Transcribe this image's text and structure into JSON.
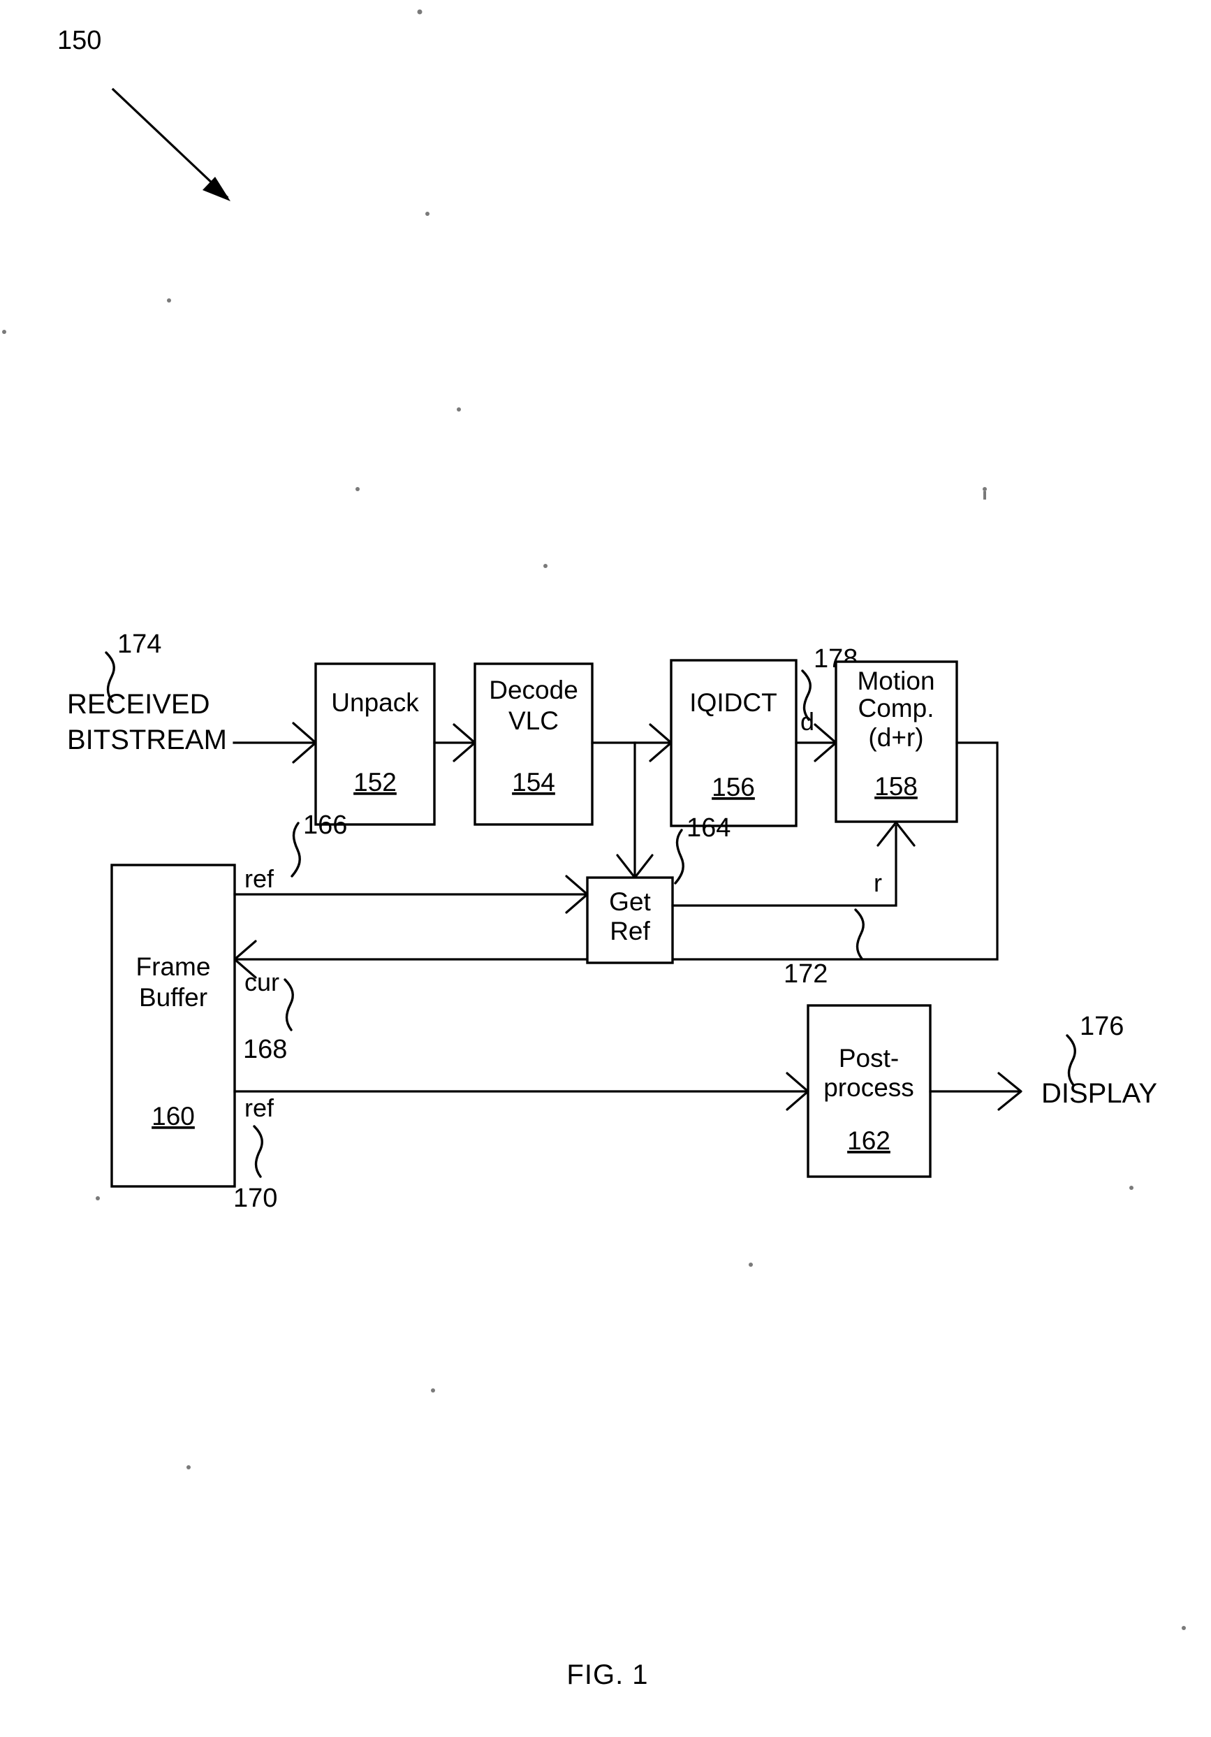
{
  "figure": {
    "caption": "FIG. 1",
    "system_tag": "150"
  },
  "blocks": [
    {
      "id": "unpack",
      "label_line1": "Unpack",
      "label_line2": "",
      "numeral": "152"
    },
    {
      "id": "decode",
      "label_line1": "Decode",
      "label_line2": "VLC",
      "numeral": "154"
    },
    {
      "id": "iqidct",
      "label_line1": "IQIDCT",
      "label_line2": "",
      "numeral": "156"
    },
    {
      "id": "motion",
      "label_line1": "Motion",
      "label_line2": "Comp.",
      "label_line3": "(d+r)",
      "numeral": "158"
    },
    {
      "id": "framebuf",
      "label_line1": "Frame",
      "label_line2": "Buffer",
      "numeral": "160"
    },
    {
      "id": "postproc",
      "label_line1": "Post-",
      "label_line2": "process",
      "numeral": "162"
    },
    {
      "id": "getref",
      "label_line1": "Get",
      "label_line2": "Ref",
      "numeral": ""
    }
  ],
  "io": {
    "input_line1": "RECEIVED",
    "input_line2": "BITSTREAM",
    "input_tag": "174",
    "output": "DISPLAY",
    "output_tag": "176"
  },
  "signals": {
    "d": "d",
    "r": "r",
    "ref_upper": "ref",
    "ref_lower": "ref",
    "cur": "cur"
  },
  "lead_tags": {
    "getref": "164",
    "ref_upper": "166",
    "cur": "168",
    "ref_lower": "170",
    "r": "172",
    "d": "178"
  }
}
